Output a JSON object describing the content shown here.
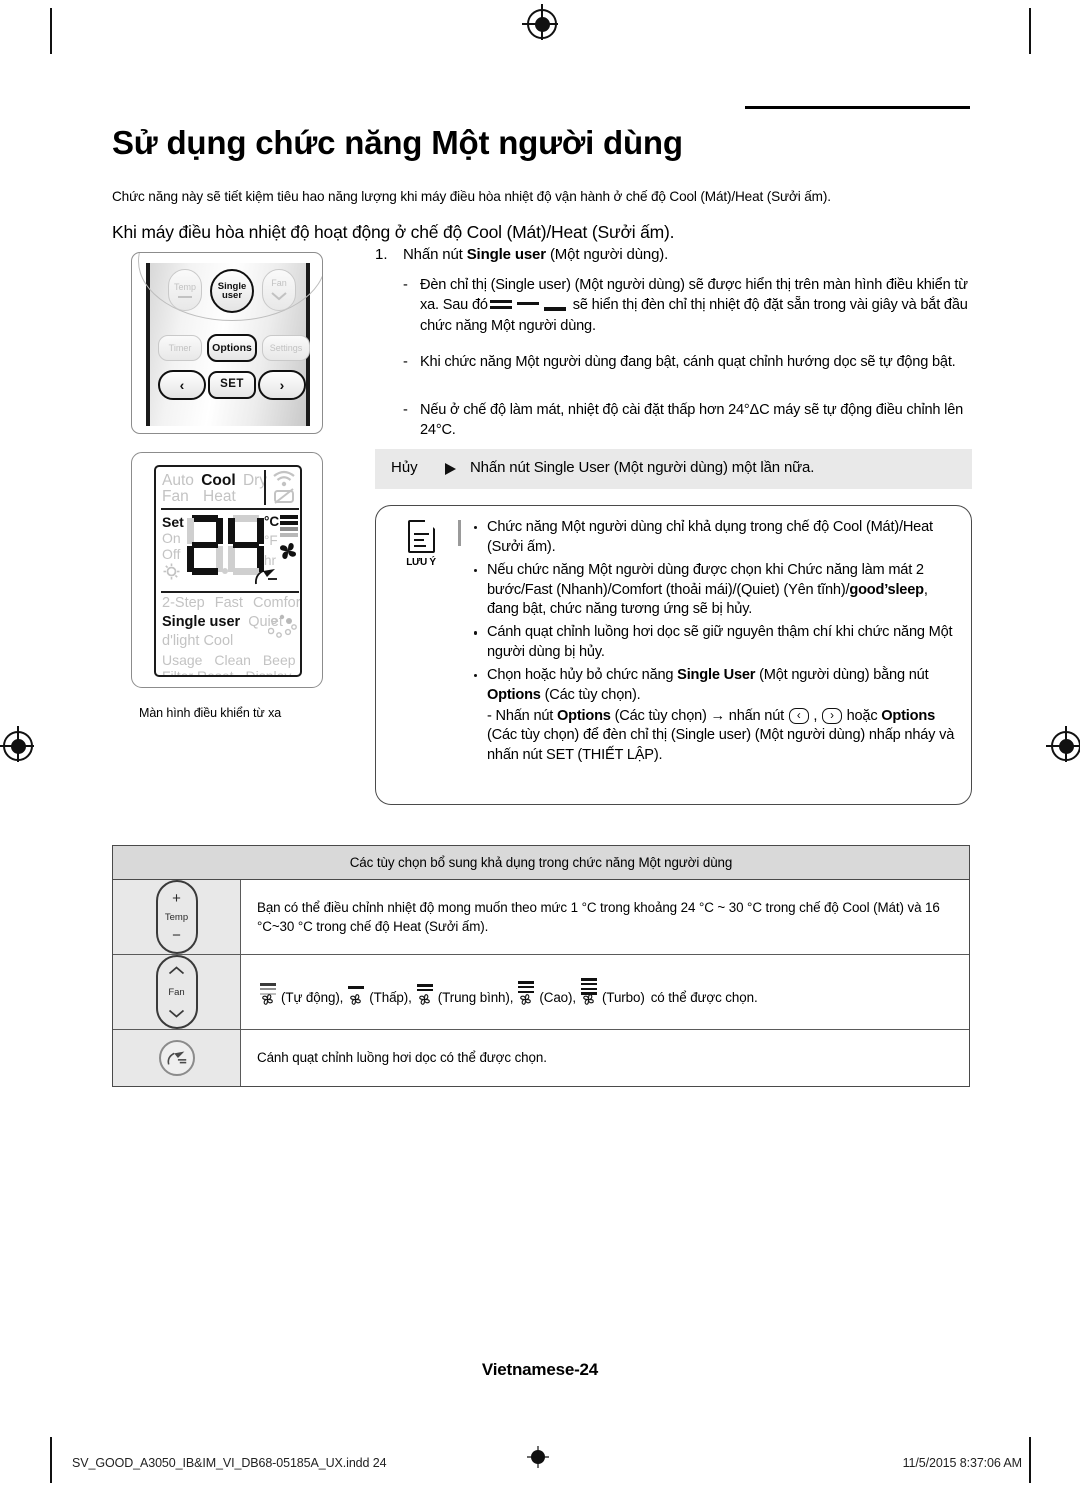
{
  "page": {
    "title": "Sử dụng chức năng Một người dùng",
    "intro_1": "Chức năng này sẽ tiết kiệm tiêu hao năng lượng khi máy điều hòa nhiệt độ vận hành ở chế độ Cool (Mát)/Heat (Sưởi ấm).",
    "intro_2": "Khi máy điều hòa nhiệt độ hoạt động ở chế độ Cool (Mát)/Heat (Sưởi ấm).",
    "page_label": "Vietnamese-24"
  },
  "remote_figure": {
    "caption": "",
    "buttons": {
      "temp": "Temp",
      "fan": "Fan",
      "single_line1": "Single",
      "single_line2": "user",
      "timer": "Timer",
      "options": "Options",
      "settings": "Settings",
      "left": "‹",
      "set": "SET",
      "right": "›"
    }
  },
  "lcd_figure": {
    "caption": "Màn hình điều khiển từ xa",
    "modes_row1": [
      "Auto",
      "Cool",
      "Dry"
    ],
    "modes_row2": [
      "Fan",
      "Heat"
    ],
    "active_mode": "Cool",
    "left_labels": [
      "Set",
      "On",
      "Off"
    ],
    "active_left_label": "Set",
    "temperature": "24",
    "unit_active": "°C",
    "unit_inactive": "°F",
    "hr_label": "hr",
    "features_row1": [
      "2-Step",
      "Fast",
      "Comfort"
    ],
    "features_row2": [
      "Single user",
      "Quiet"
    ],
    "features_row3": [
      "d'light Cool"
    ],
    "features_row4": [
      "Usage",
      "Clean",
      "Beep"
    ],
    "features_row5": [
      "Filter Reset",
      "Display"
    ],
    "active_feature": "Single user"
  },
  "steps": {
    "number": "1.",
    "head_prefix": "Nhấn nút ",
    "head_bold": "Single user",
    "head_suffix": " (Một người dùng).",
    "sub_1_a": "Đèn chỉ thị (Single user) (Một người dùng) sẽ được hiển thị trên màn hình điều khiển từ xa. Sau đó",
    "sub_1_b": "sẽ hiển thị đèn chỉ thị nhiệt độ đặt sẵn trong vài giây và bắt đầu chức năng Một người dùng.",
    "sub_2": "Khi chức năng Một người dùng đang bật, cánh quạt chỉnh hướng dọc sẽ tự động bật.",
    "sub_3": "Nếu ở chế độ làm mát, nhiệt độ cài đặt thấp hơn 24°ΔC máy sẽ tự động điều chỉnh lên 24°C.",
    "dash_marker": "-"
  },
  "cancel": {
    "label": "Hủy",
    "text": "Nhấn nút Single User (Một người dùng) một lần nữa."
  },
  "note": {
    "icon_label": "LƯU Ý",
    "items": [
      {
        "text": "Chức năng Một người dùng chỉ khả dụng trong chế độ Cool (Mát)/Heat (Sưởi ấm)."
      },
      {
        "text_a": "Nếu chức năng Một người dùng được chọn khi Chức năng làm mát 2 bước/Fast (Nhanh)/Comfort (thoải mái)/(Quiet) (Yên tĩnh)/",
        "bold": "good’sleep",
        "text_b": ", đang bật, chức năng tương ứng sẽ bị hủy."
      },
      {
        "text": "Cánh quạt chỉnh luồng hơi dọc sẽ giữ nguyên thậm chí khi chức năng Một người dùng bị hủy."
      },
      {
        "text_a": "Chọn hoặc hủy bỏ chức năng ",
        "bold_a": "Single User",
        "text_b": " (Một người dùng) bằng nút ",
        "bold_b": "Options",
        "text_c": " (Các tùy chọn).",
        "sub_a": "- Nhấn nút ",
        "sub_bold_a": "Options",
        "sub_b": " (Các tùy chọn) → nhấn nút ",
        "key_left": "‹",
        "sub_c": " , ",
        "key_right": "›",
        "sub_d": " hoặc ",
        "sub_bold_b": "Options",
        "sub_e": " (Các tùy chọn) để đèn chỉ thị (Single user) (Một người dùng) nhấp nháy và nhấn nút SET (THIẾT LẬP)."
      }
    ]
  },
  "options_table": {
    "header": "Các tùy chọn bổ sung khả dụng trong chức năng Một người dùng",
    "rows": [
      {
        "icon": "temp-button",
        "icon_label": "Temp",
        "text": "Bạn có thể điều chỉnh nhiệt độ mong muốn theo mức 1 °C trong khoảng 24 °C ~ 30 °C trong chế độ Cool (Mát) và 16 °C~30 °C trong chế độ Heat (Sưởi ấm)."
      },
      {
        "icon": "fan-button",
        "icon_label": "Fan",
        "speeds": [
          {
            "name": "Tự động",
            "bars": 3,
            "gray": true
          },
          {
            "name": "Thấp",
            "bars": 1,
            "gray": false
          },
          {
            "name": "Trung bình",
            "bars": 2,
            "gray": false
          },
          {
            "name": "Cao",
            "bars": 3,
            "gray": false
          },
          {
            "name": "Turbo",
            "bars": 4,
            "gray": false
          }
        ],
        "suffix": "có thể được chọn."
      },
      {
        "icon": "airflow-button",
        "icon_label": "",
        "text": "Cánh quạt chỉnh luồng hơi dọc có thể được chọn."
      }
    ]
  },
  "footer": {
    "left": "SV_GOOD_A3050_IB&IM_VI_DB68-05185A_UX.indd   24",
    "right": "11/5/2015   8:37:06 AM"
  },
  "colors": {
    "ink": "#000000",
    "lcd_dim": "#c3c3c3",
    "band_gray": "#e9e9e9",
    "table_head": "#d9d9d9",
    "table_icon_cell": "#e8e8e8"
  }
}
